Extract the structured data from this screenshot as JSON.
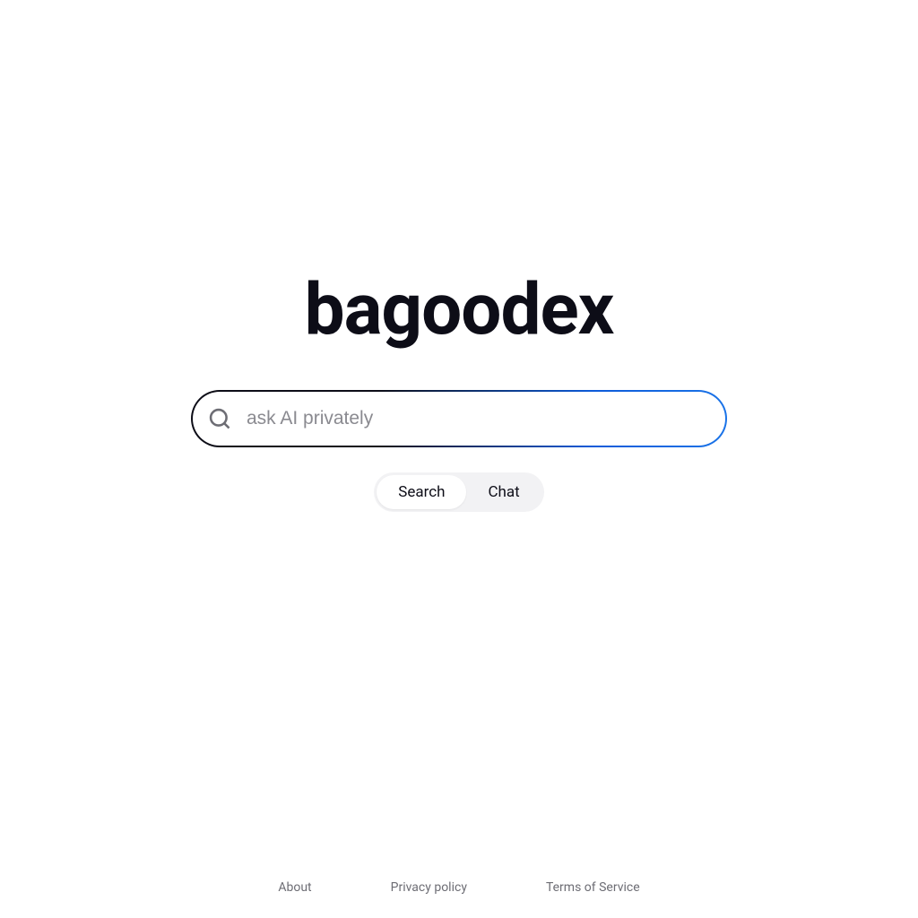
{
  "brand": "bagoodex",
  "search": {
    "placeholder": "ask AI privately",
    "value": ""
  },
  "toggle": {
    "search_label": "Search",
    "chat_label": "Chat",
    "active": "search"
  },
  "footer": {
    "about": "About",
    "privacy": "Privacy policy",
    "terms": "Terms of Service"
  },
  "colors": {
    "text_dark": "#0d0d17",
    "placeholder": "#8a8a90",
    "icon_gray": "#6d6d74",
    "accent_blue": "#1a73e8",
    "toggle_bg": "#f2f2f4"
  }
}
